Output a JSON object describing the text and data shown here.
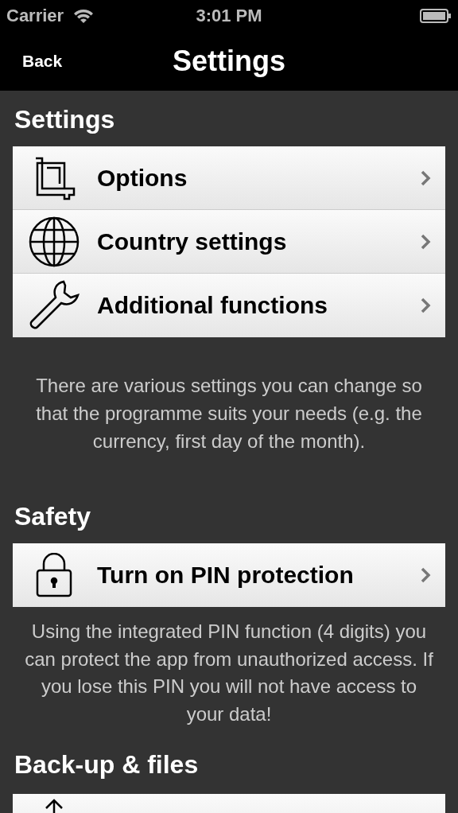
{
  "status_bar": {
    "carrier": "Carrier",
    "time": "3:01 PM"
  },
  "nav_bar": {
    "back": "Back",
    "title": "Settings"
  },
  "sections": [
    {
      "title": "Settings",
      "rows": [
        {
          "kind": "crop",
          "label": "Options"
        },
        {
          "kind": "globe",
          "label": "Country settings"
        },
        {
          "kind": "wrench",
          "label": "Additional functions"
        }
      ],
      "note": "There are various settings you can change so that the programme suits your needs (e.g. the currency, first day of the month)."
    },
    {
      "title": "Safety",
      "rows": [
        {
          "kind": "lock",
          "label": "Turn on PIN protection"
        }
      ],
      "note": "Using the integrated PIN function (4 digits) you can protect the app from unauthorized access. If you lose this PIN you will not have access to your data!"
    },
    {
      "title": "Back-up & files",
      "rows": [
        {
          "kind": "upload"
        }
      ]
    }
  ]
}
